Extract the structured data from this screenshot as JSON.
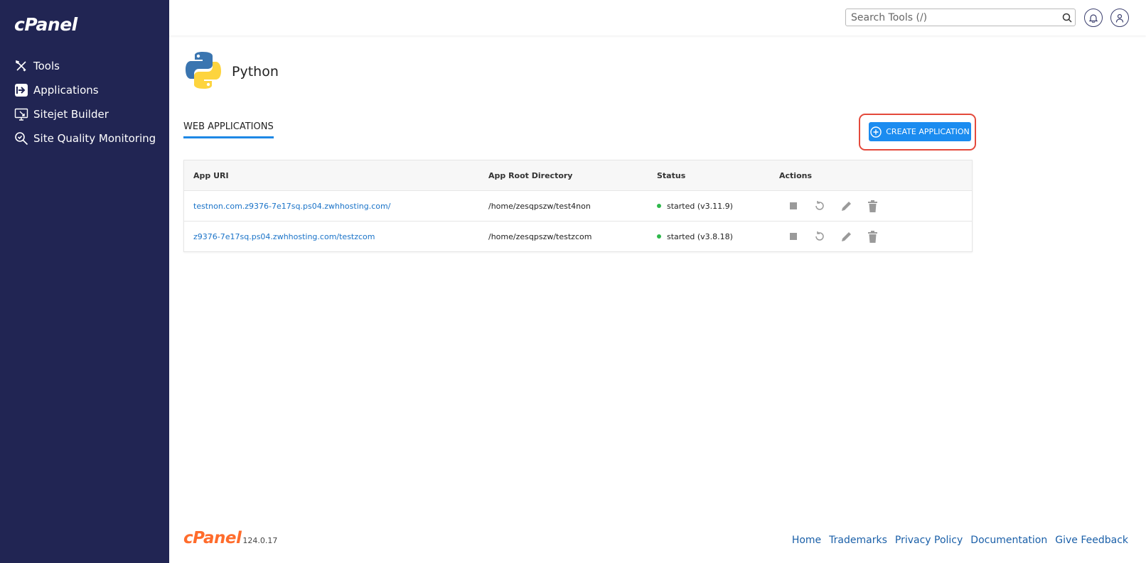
{
  "brand": {
    "logo_text": "cPanel"
  },
  "sidebar": {
    "items": [
      {
        "label": "Tools",
        "icon": "tools-icon"
      },
      {
        "label": "Applications",
        "icon": "applications-icon"
      },
      {
        "label": "Sitejet Builder",
        "icon": "sitejet-icon"
      },
      {
        "label": "Site Quality Monitoring",
        "icon": "magnifier-icon"
      }
    ]
  },
  "topbar": {
    "search_placeholder": "Search Tools (/)",
    "notifications_icon": "bell-icon",
    "user_icon": "user-icon"
  },
  "page": {
    "title": "Python",
    "icon": "python-logo-icon",
    "tab_label": "WEB APPLICATIONS",
    "create_button_label": "CREATE APPLICATION"
  },
  "table": {
    "headers": [
      "App URI",
      "App Root Directory",
      "Status",
      "Actions"
    ],
    "rows": [
      {
        "uri": "testnon.com.z9376-7e17sq.ps04.zwhhosting.com/",
        "root": "/home/zesqpszw/test4non",
        "status": "started (v3.11.9)"
      },
      {
        "uri": "z9376-7e17sq.ps04.zwhhosting.com/testzcom",
        "root": "/home/zesqpszw/testzcom",
        "status": "started (v3.8.18)"
      }
    ],
    "action_icons": [
      "stop-icon",
      "restart-icon",
      "edit-icon",
      "delete-icon"
    ]
  },
  "footer": {
    "logo_text": "cPanel",
    "version": "124.0.17",
    "links": [
      "Home",
      "Trademarks",
      "Privacy Policy",
      "Documentation",
      "Give Feedback"
    ]
  },
  "colors": {
    "sidebar_bg": "#212553",
    "accent": "#1b8cf0",
    "highlight_border": "#e4493b",
    "status_green": "#2eb84b",
    "footer_brand": "#ff6c2c"
  }
}
